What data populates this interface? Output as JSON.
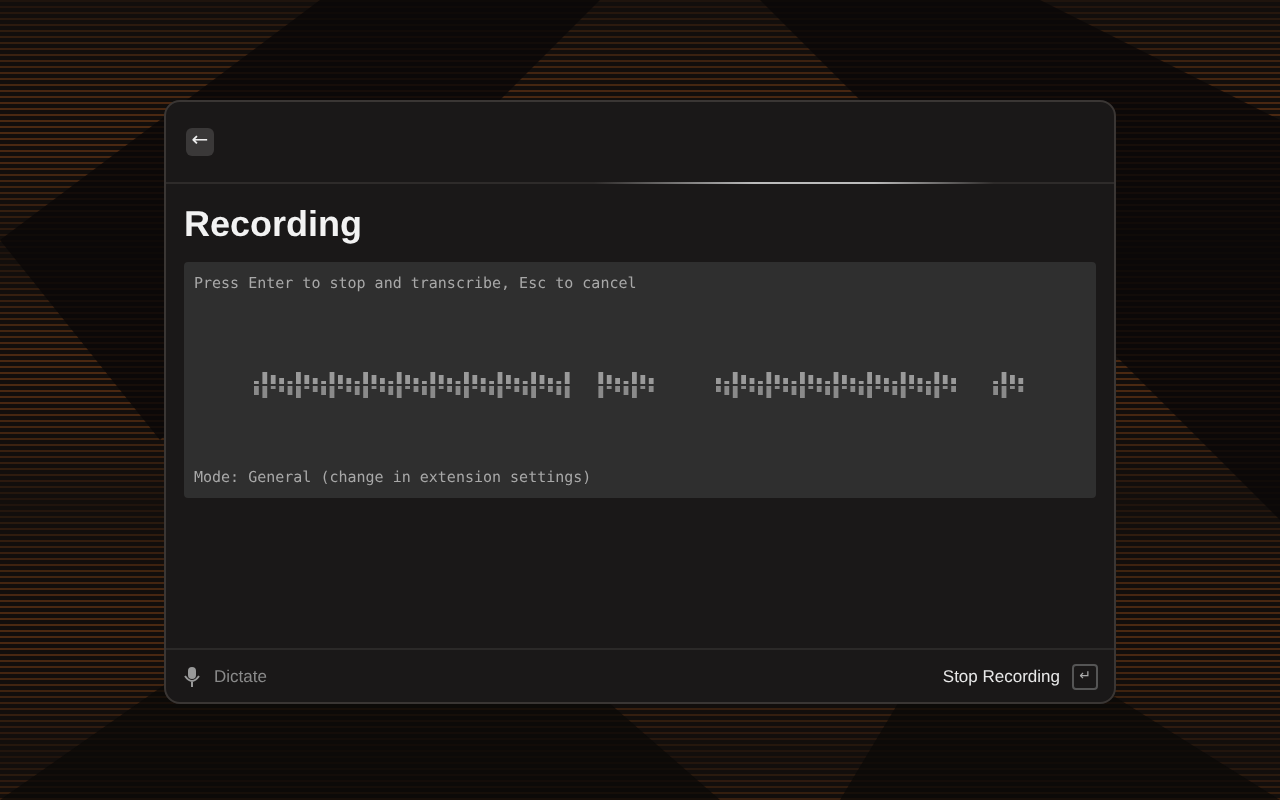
{
  "header": {
    "back_button": "←"
  },
  "title": "Recording",
  "panel": {
    "hint": "Press Enter to stop and transcribe,  Esc to cancel",
    "mode": "Mode: General (change in extension settings)"
  },
  "footer": {
    "left_action": "Dictate",
    "right_action": "Stop Recording",
    "key_hint": "↵"
  }
}
